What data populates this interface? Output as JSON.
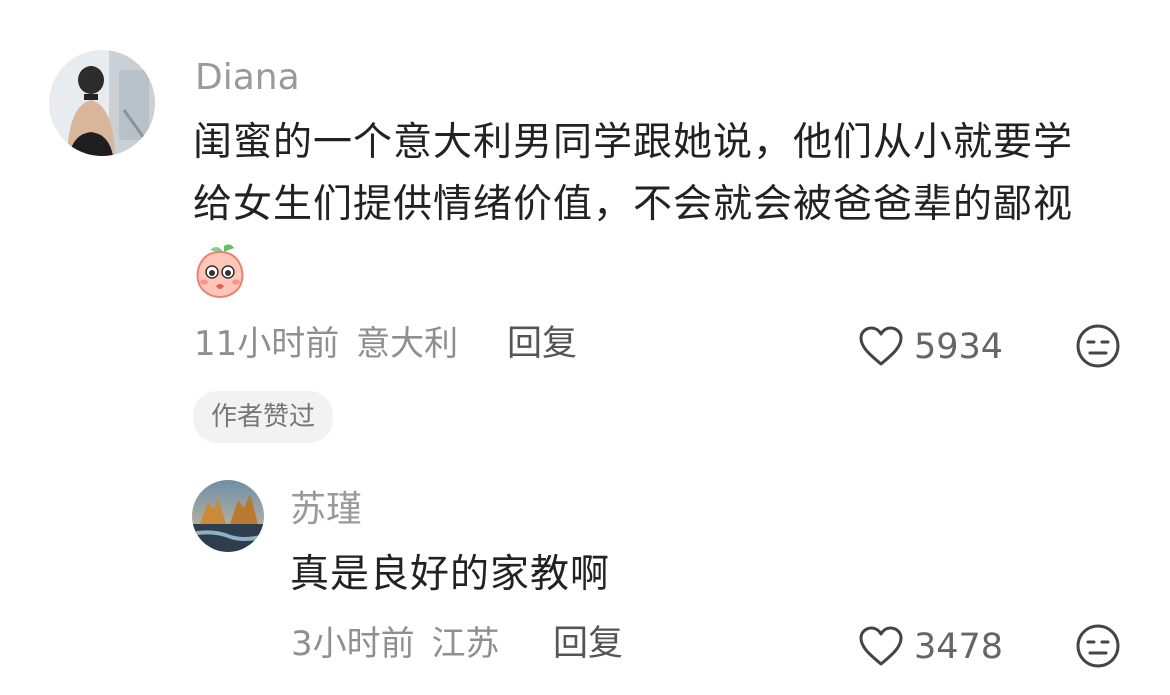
{
  "comment": {
    "username": "Diana",
    "text_line1": "闺蜜的一个意大利男同学跟她说，他们从小就要学",
    "text_line2": "给女生们提供情绪价值，不会就会被爸爸辈的鄙视",
    "emoji_icon": "peach-face-icon",
    "time": "11小时前",
    "location": "意大利",
    "reply_label": "回复",
    "like_count": "5934",
    "author_liked_badge": "作者赞过",
    "dislike_icon": "meh-face-icon",
    "like_icon": "heart-outline-icon"
  },
  "reply": {
    "username": "苏瑾",
    "text": "真是良好的家教啊",
    "time": "3小时前",
    "location": "江苏",
    "reply_label": "回复",
    "like_count": "3478",
    "dislike_icon": "meh-face-icon",
    "like_icon": "heart-outline-icon"
  }
}
